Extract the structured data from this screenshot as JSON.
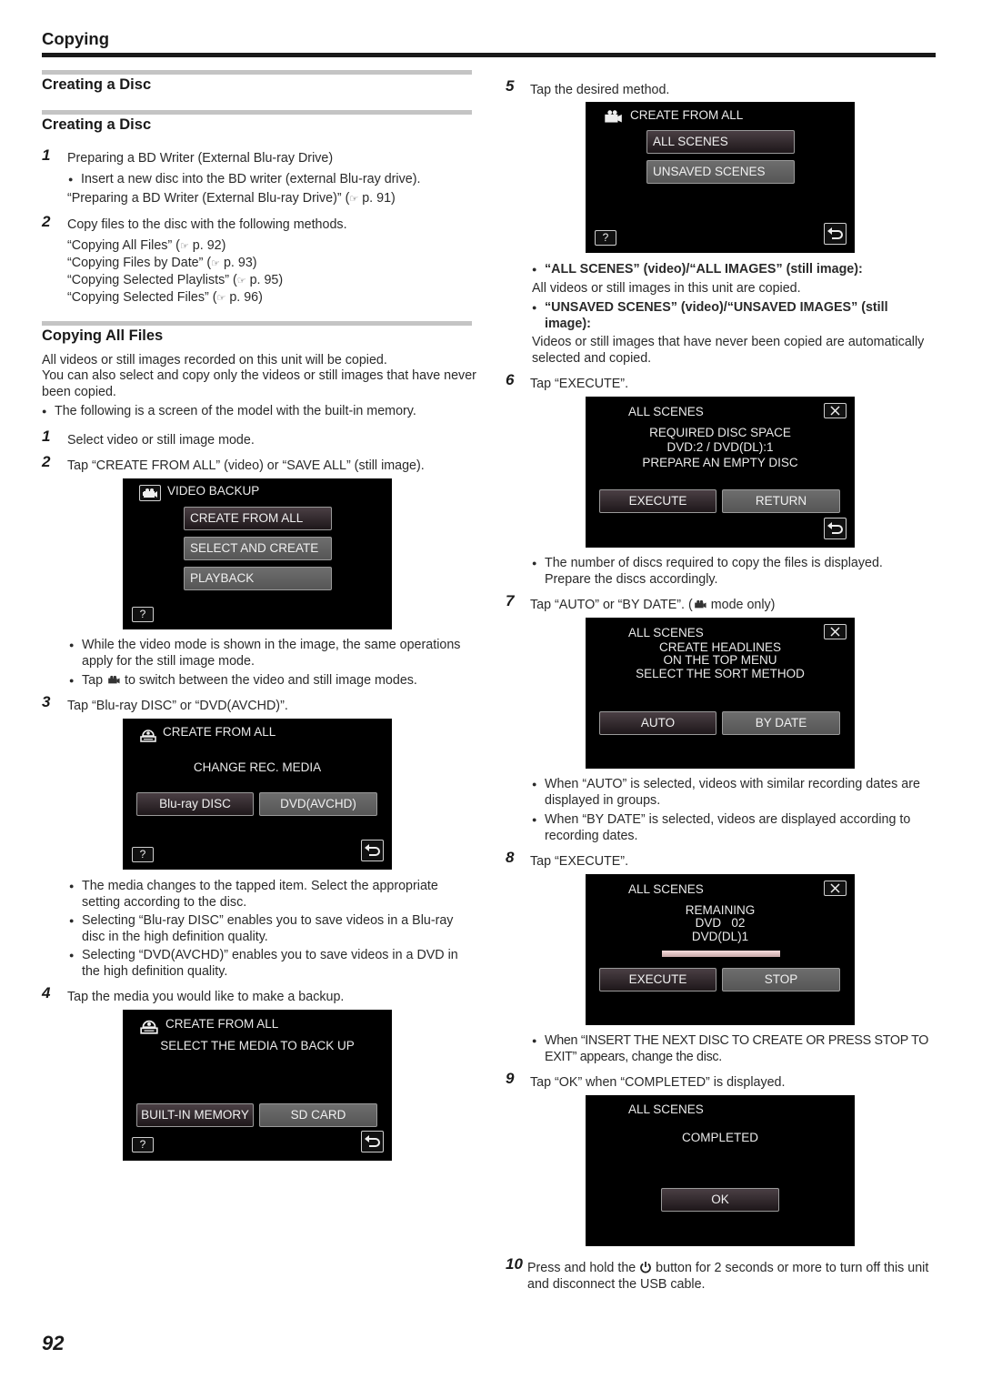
{
  "page": {
    "header": "Copying",
    "page_number": "92"
  },
  "left": {
    "section1_title": "Creating a Disc",
    "section2_title": "Creating a Disc",
    "steps_a": [
      {
        "num": "1",
        "text": "Preparing a BD Writer (External Blu-ray Drive)",
        "bullet": "Insert a new disc into the BD writer (external Blu-ray drive).",
        "ref_text": "“Preparing a BD Writer (External Blu-ray Drive)” (",
        "ref_page": " p. 91)"
      },
      {
        "num": "2",
        "text": "Copy files to the disc with the following methods.",
        "refs": [
          {
            "text": "“Copying All Files” (",
            "page": " p. 92)"
          },
          {
            "text": "“Copying Files by Date” (",
            "page": " p. 93)"
          },
          {
            "text": "“Copying Selected Playlists” (",
            "page": " p. 95)"
          },
          {
            "text": "“Copying Selected Files” (",
            "page": " p. 96)"
          }
        ]
      }
    ],
    "section3_title": "Copying All Files",
    "intro_line1": "All videos or still images recorded on this unit will be copied.",
    "intro_line2": "You can also select and copy only the videos or still images that have never been copied.",
    "intro_bullet": "The following is a screen of the model with the built-in memory.",
    "steps_b": [
      {
        "num": "1",
        "text": "Select video or still image mode."
      },
      {
        "num": "2",
        "text": "Tap “CREATE FROM ALL” (video) or “SAVE ALL” (still image)."
      },
      {
        "num": "3",
        "text": "Tap “Blu-ray DISC” or “DVD(AVCHD)”."
      },
      {
        "num": "4",
        "text": "Tap the media you would like to make a backup."
      }
    ],
    "step2_bullets": [
      "While the video mode is shown in the image, the same operations apply for the still image mode.",
      "Tap",
      "to switch between the video and still image modes."
    ],
    "step3_bullets": [
      "The media changes to the tapped item. Select the appropriate setting according to the disc.",
      "Selecting “Blu-ray DISC” enables you to save videos in a Blu-ray disc in the high definition quality.",
      "Selecting “DVD(AVCHD)” enables you to save videos in a DVD in the high definition quality."
    ]
  },
  "screens": {
    "video_backup": {
      "title": "VIDEO BACKUP",
      "buttons": [
        "CREATE FROM ALL",
        "SELECT AND CREATE",
        "PLAYBACK"
      ],
      "help": "?"
    },
    "change_media": {
      "title": "CREATE FROM ALL",
      "message": "CHANGE REC. MEDIA",
      "buttons": [
        "Blu-ray DISC",
        "DVD(AVCHD)"
      ],
      "help": "?"
    },
    "select_media": {
      "title": "CREATE FROM ALL",
      "message": "SELECT THE MEDIA TO BACK UP",
      "buttons": [
        "BUILT-IN MEMORY",
        "SD CARD"
      ],
      "help": "?"
    },
    "method": {
      "title": "CREATE FROM ALL",
      "buttons": [
        "ALL SCENES",
        "UNSAVED SCENES"
      ],
      "help": "?"
    },
    "required_space": {
      "title": "ALL SCENES",
      "lines": [
        "REQUIRED DISC SPACE",
        "DVD:2 / DVD(DL):1",
        "PREPARE AN EMPTY DISC"
      ],
      "buttons": [
        "EXECUTE",
        "RETURN"
      ]
    },
    "sort_method": {
      "title": "ALL SCENES",
      "lines": [
        "CREATE HEADLINES",
        "ON THE TOP MENU",
        "SELECT THE SORT METHOD"
      ],
      "buttons": [
        "AUTO",
        "BY DATE"
      ]
    },
    "remaining": {
      "title": "ALL SCENES",
      "lines": [
        "REMAINING",
        "DVD   02",
        "DVD(DL)1"
      ],
      "progress_percent": 100,
      "buttons": [
        "EXECUTE",
        "STOP"
      ]
    },
    "completed": {
      "title": "ALL SCENES",
      "message": "COMPLETED",
      "button": "OK"
    }
  },
  "right": {
    "step5": {
      "num": "5",
      "text": "Tap the desired method."
    },
    "step5_items": [
      {
        "heading": "“ALL SCENES” (video)/“ALL IMAGES” (still image):",
        "desc": "All videos or still images in this unit are copied."
      },
      {
        "heading": "“UNSAVED SCENES” (video)/“UNSAVED IMAGES” (still image):",
        "desc": "Videos or still images that have never been copied are automatically selected and copied."
      }
    ],
    "step6": {
      "num": "6",
      "text": "Tap “EXECUTE”."
    },
    "step6_bullet": "The number of discs required to copy the files is displayed. Prepare the discs accordingly.",
    "step7": {
      "num": "7",
      "text_a": "Tap “AUTO” or “BY DATE”. (",
      "text_b": " mode only)"
    },
    "step7_bullets": [
      "When “AUTO” is selected, videos with similar recording dates are displayed in groups.",
      "When “BY DATE” is selected, videos are displayed according to recording dates."
    ],
    "step8": {
      "num": "8",
      "text": "Tap “EXECUTE”."
    },
    "step8_bullet": "When “INSERT THE NEXT DISC TO CREATE OR PRESS STOP TO EXIT” appears, change the disc.",
    "step9": {
      "num": "9",
      "text": "Tap “OK” when “COMPLETED” is displayed."
    },
    "step10": {
      "num": "10",
      "text_a": "Press and hold the ",
      "text_b": " button for 2 seconds or more to turn off this unit and disconnect the USB cable."
    }
  }
}
